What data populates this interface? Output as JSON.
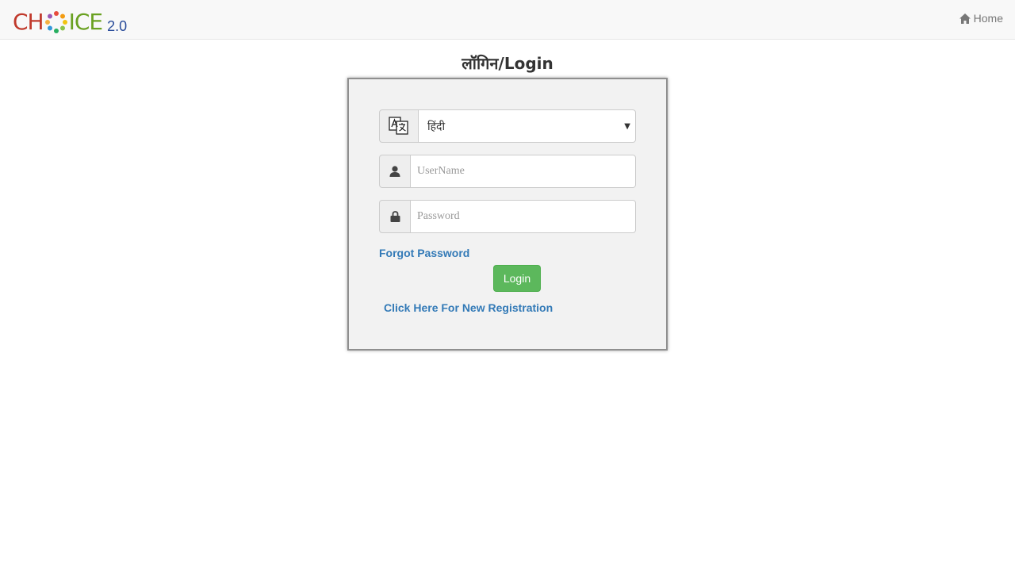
{
  "brand": {
    "logo_text_left": "CH",
    "logo_text_right": "ICE",
    "logo_version": "2.0"
  },
  "nav": {
    "home_label": "Home",
    "home_icon": "home-icon"
  },
  "page": {
    "title": "लॉगिन/Login"
  },
  "form": {
    "language": {
      "icon": "translate-icon",
      "selected": "हिंदी"
    },
    "username": {
      "icon": "user-icon",
      "placeholder": "UserName",
      "value": ""
    },
    "password": {
      "icon": "lock-icon",
      "placeholder": "Password",
      "value": ""
    },
    "forgot_label": "Forgot Password",
    "login_label": "Login",
    "register_label": "Click Here For New Registration"
  },
  "colors": {
    "brand_red": "#c0392b",
    "brand_green": "#6aa121",
    "brand_blue": "#2a4d9b",
    "link": "#337ab7",
    "button": "#5cb85c"
  }
}
